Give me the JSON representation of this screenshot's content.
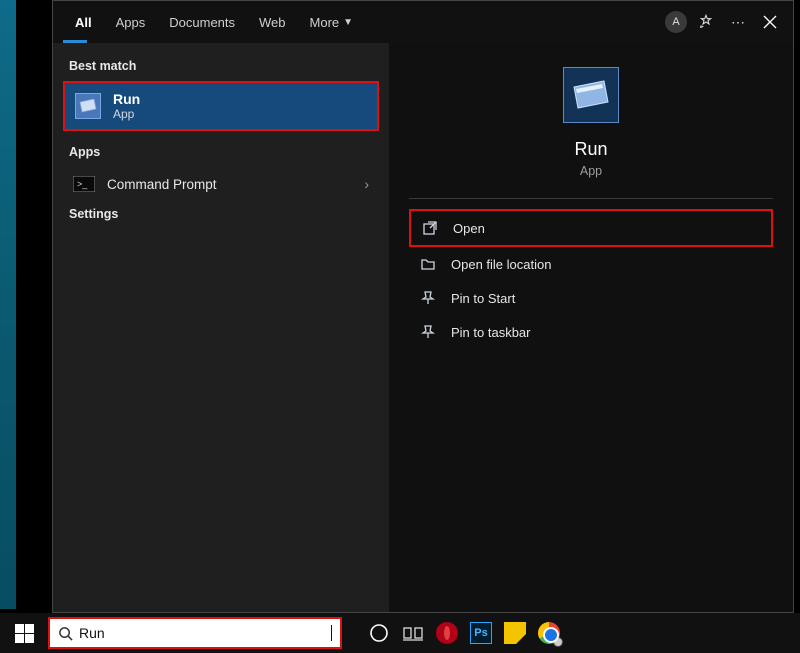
{
  "tabs": {
    "all": "All",
    "apps": "Apps",
    "documents": "Documents",
    "web": "Web",
    "more": "More"
  },
  "top_right": {
    "avatar_letter": "A"
  },
  "left": {
    "best_match_label": "Best match",
    "best_match": {
      "title": "Run",
      "subtitle": "App"
    },
    "apps_label": "Apps",
    "apps": [
      {
        "label": "Command Prompt"
      }
    ],
    "settings_label": "Settings"
  },
  "right": {
    "app_title": "Run",
    "app_subtitle": "App",
    "actions": {
      "open": "Open",
      "open_file_location": "Open file location",
      "pin_to_start": "Pin to Start",
      "pin_to_taskbar": "Pin to taskbar"
    }
  },
  "taskbar": {
    "search_value": "Run",
    "ps_label": "Ps"
  }
}
